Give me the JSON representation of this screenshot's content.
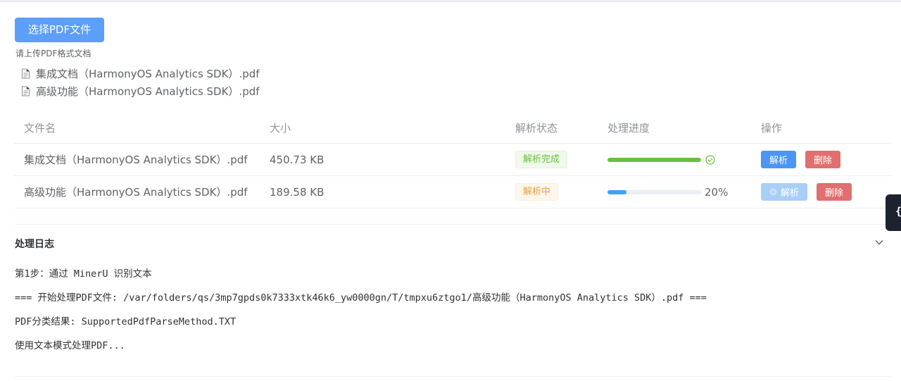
{
  "upload": {
    "button_label": "选择PDF文件",
    "tip": "请上传PDF格式文档",
    "files": [
      {
        "name": "集成文档（HarmonyOS Analytics SDK）.pdf",
        "icon": "document-icon"
      },
      {
        "name": "高级功能（HarmonyOS Analytics SDK）.pdf",
        "icon": "document-icon"
      }
    ]
  },
  "table": {
    "headers": {
      "name": "文件名",
      "size": "大小",
      "status": "解析状态",
      "progress": "处理进度",
      "actions": "操作"
    },
    "rows": [
      {
        "name": "集成文档（HarmonyOS Analytics SDK）.pdf",
        "size": "450.73 KB",
        "status": "解析完成",
        "progress": 1.0,
        "progress_text": "",
        "parse_label": "解析",
        "delete_label": "删除",
        "parse_disabled": false
      },
      {
        "name": "高级功能（HarmonyOS Analytics SDK）.pdf",
        "size": "189.58 KB",
        "status": "解析中",
        "progress": 0.2,
        "progress_text": "20%",
        "parse_label": "解析",
        "delete_label": "删除",
        "parse_disabled": true
      }
    ]
  },
  "log": {
    "title": "处理日志",
    "lines": [
      "第1步：通过 MinerU 识别文本",
      "=== 开始处理PDF文件: /var/folders/qs/3mp7gpds0k7333xtk46k6_yw0000gn/T/tmpxu6ztgo1/高级功能（HarmonyOS Analytics SDK）.pdf ===",
      "PDF分类结果: SupportedPdfParseMethod.TXT",
      "使用文本模式处理PDF..."
    ]
  },
  "side_tab": {
    "label": "{}"
  },
  "colors": {
    "primary": "#409eff",
    "success": "#67c23a",
    "warning": "#e6a23c",
    "danger": "#e06f6f"
  }
}
